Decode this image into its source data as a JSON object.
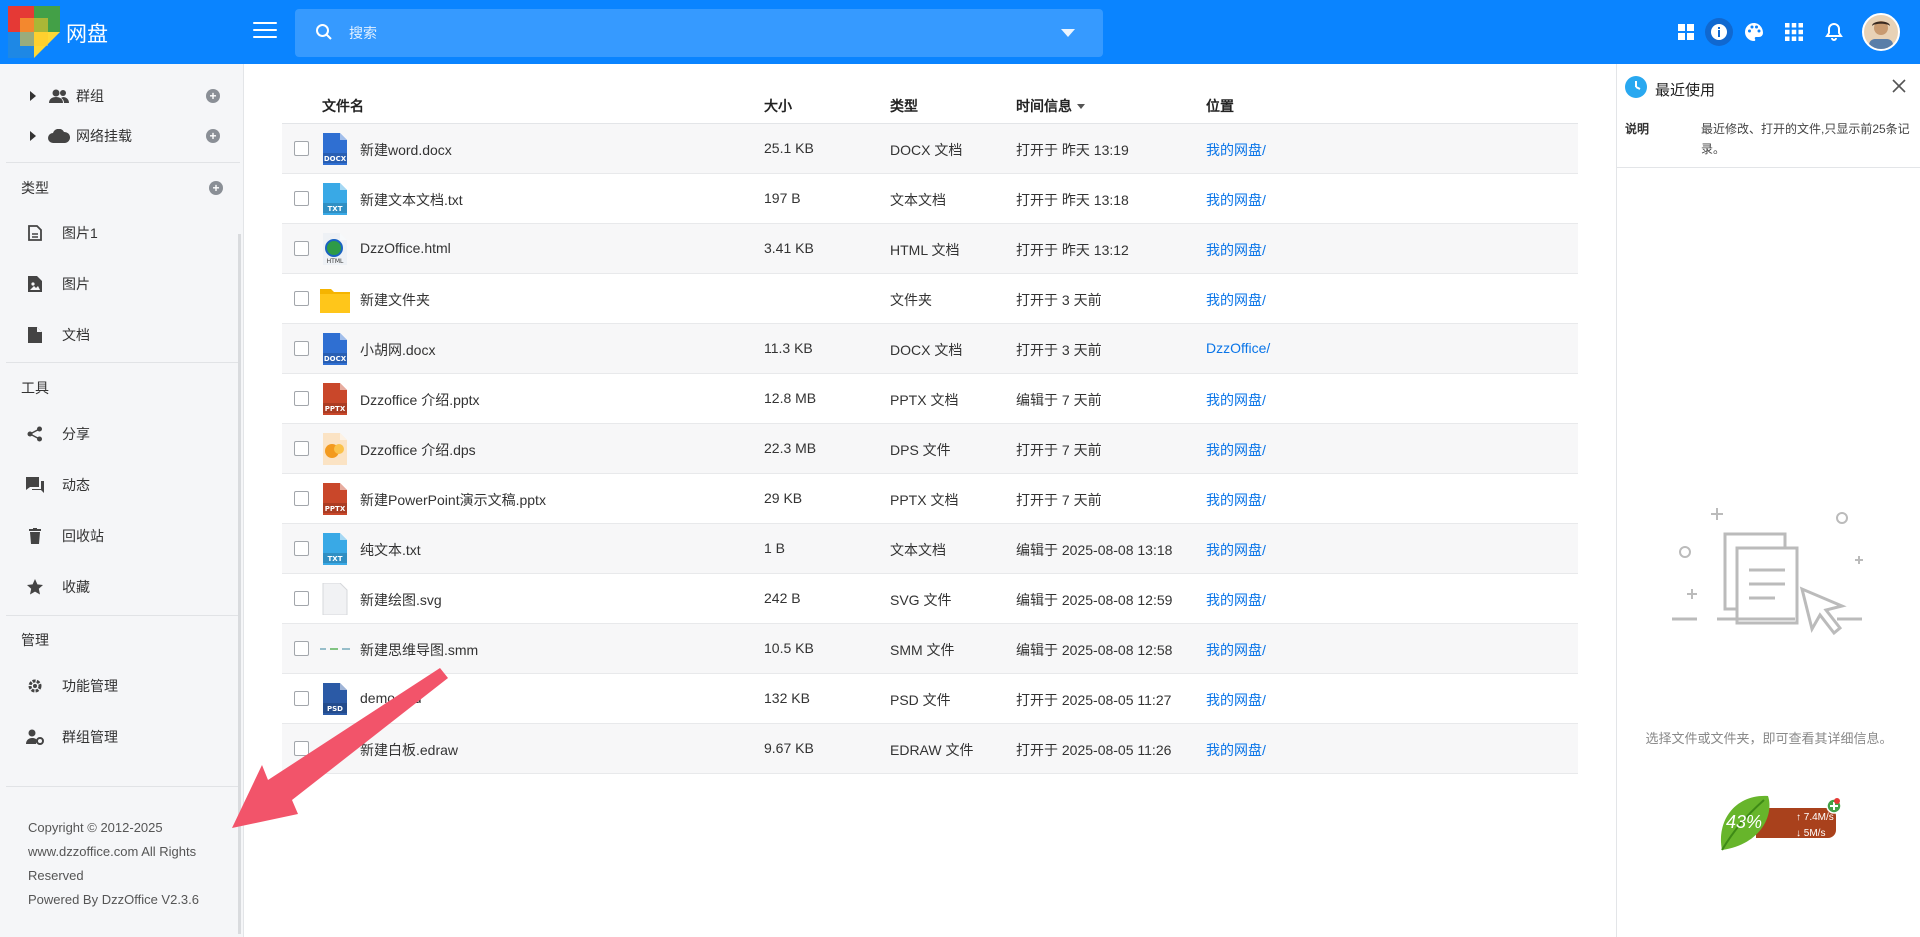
{
  "header": {
    "brand": "网盘",
    "search_placeholder": "搜索",
    "icons": [
      "grid-view-icon",
      "info-icon",
      "palette-icon",
      "apps-icon",
      "bell-icon"
    ]
  },
  "sidebar": {
    "tree": [
      {
        "label": "群组",
        "icon": "group-icon"
      },
      {
        "label": "网络挂载",
        "icon": "cloud-icon"
      }
    ],
    "sections": {
      "types": "类型",
      "tools": "工具",
      "admin": "管理"
    },
    "type_items": [
      {
        "label": "图片1",
        "icon": "document-icon"
      },
      {
        "label": "图片",
        "icon": "image-file-icon"
      },
      {
        "label": "文档",
        "icon": "file-icon"
      }
    ],
    "tool_items": [
      {
        "label": "分享",
        "icon": "share-icon"
      },
      {
        "label": "动态",
        "icon": "chat-icon"
      },
      {
        "label": "回收站",
        "icon": "trash-icon"
      },
      {
        "label": "收藏",
        "icon": "star-icon"
      }
    ],
    "admin_items": [
      {
        "label": "功能管理",
        "icon": "gear-icon"
      },
      {
        "label": "群组管理",
        "icon": "user-settings-icon"
      }
    ],
    "footer": {
      "line1": "Copyright © 2012-2025",
      "line2": "www.dzzoffice.com All Rights",
      "line3": "Reserved",
      "line4": "Powered By DzzOffice V2.3.6"
    }
  },
  "table": {
    "columns": {
      "name": "文件名",
      "size": "大小",
      "type": "类型",
      "time": "时间信息",
      "location": "位置"
    },
    "rows": [
      {
        "name": "新建word.docx",
        "size": "25.1 KB",
        "type": "DOCX 文档",
        "time": "打开于 昨天 13:19",
        "location": "我的网盘/",
        "icon": "docx"
      },
      {
        "name": "新建文本文档.txt",
        "size": "197 B",
        "type": "文本文档",
        "time": "打开于 昨天 13:18",
        "location": "我的网盘/",
        "icon": "txt"
      },
      {
        "name": "DzzOffice.html",
        "size": "3.41 KB",
        "type": "HTML 文档",
        "time": "打开于 昨天 13:12",
        "location": "我的网盘/",
        "icon": "html"
      },
      {
        "name": "新建文件夹",
        "size": "",
        "type": "文件夹",
        "time": "打开于 3 天前",
        "location": "我的网盘/",
        "icon": "folder"
      },
      {
        "name": "小胡网.docx",
        "size": "11.3 KB",
        "type": "DOCX 文档",
        "time": "打开于 3 天前",
        "location": "DzzOffice/",
        "icon": "docx"
      },
      {
        "name": "Dzzoffice 介绍.pptx",
        "size": "12.8 MB",
        "type": "PPTX 文档",
        "time": "编辑于 7 天前",
        "location": "我的网盘/",
        "icon": "pptx"
      },
      {
        "name": "Dzzoffice 介绍.dps",
        "size": "22.3 MB",
        "type": "DPS 文件",
        "time": "打开于 7 天前",
        "location": "我的网盘/",
        "icon": "dps"
      },
      {
        "name": "新建PowerPoint演示文稿.pptx",
        "size": "29 KB",
        "type": "PPTX 文档",
        "time": "打开于 7 天前",
        "location": "我的网盘/",
        "icon": "pptx"
      },
      {
        "name": "纯文本.txt",
        "size": "1 B",
        "type": "文本文档",
        "time": "编辑于 2025-08-08 13:18",
        "location": "我的网盘/",
        "icon": "txt"
      },
      {
        "name": "新建绘图.svg",
        "size": "242 B",
        "type": "SVG 文件",
        "time": "编辑于 2025-08-08 12:59",
        "location": "我的网盘/",
        "icon": "svg"
      },
      {
        "name": "新建思维导图.smm",
        "size": "10.5 KB",
        "type": "SMM 文件",
        "time": "编辑于 2025-08-08 12:58",
        "location": "我的网盘/",
        "icon": "smm"
      },
      {
        "name": "demo.psd",
        "size": "132 KB",
        "type": "PSD 文件",
        "time": "打开于 2025-08-05 11:27",
        "location": "我的网盘/",
        "icon": "psd"
      },
      {
        "name": "新建白板.edraw",
        "size": "9.67 KB",
        "type": "EDRAW 文件",
        "time": "打开于 2025-08-05 11:26",
        "location": "我的网盘/",
        "icon": "edraw"
      }
    ]
  },
  "right_panel": {
    "title": "最近使用",
    "label": "说明",
    "description": "最近修改、打开的文件,只显示前25条记录。",
    "hint": "选择文件或文件夹，即可查看其详细信息。"
  },
  "speed_widget": {
    "percent": "43%",
    "up": "7.4M/s",
    "down": "5M/s"
  },
  "colors": {
    "topbar": "#0a84ff",
    "link": "#0a75e8",
    "annotation_arrow": "#f2546a"
  }
}
